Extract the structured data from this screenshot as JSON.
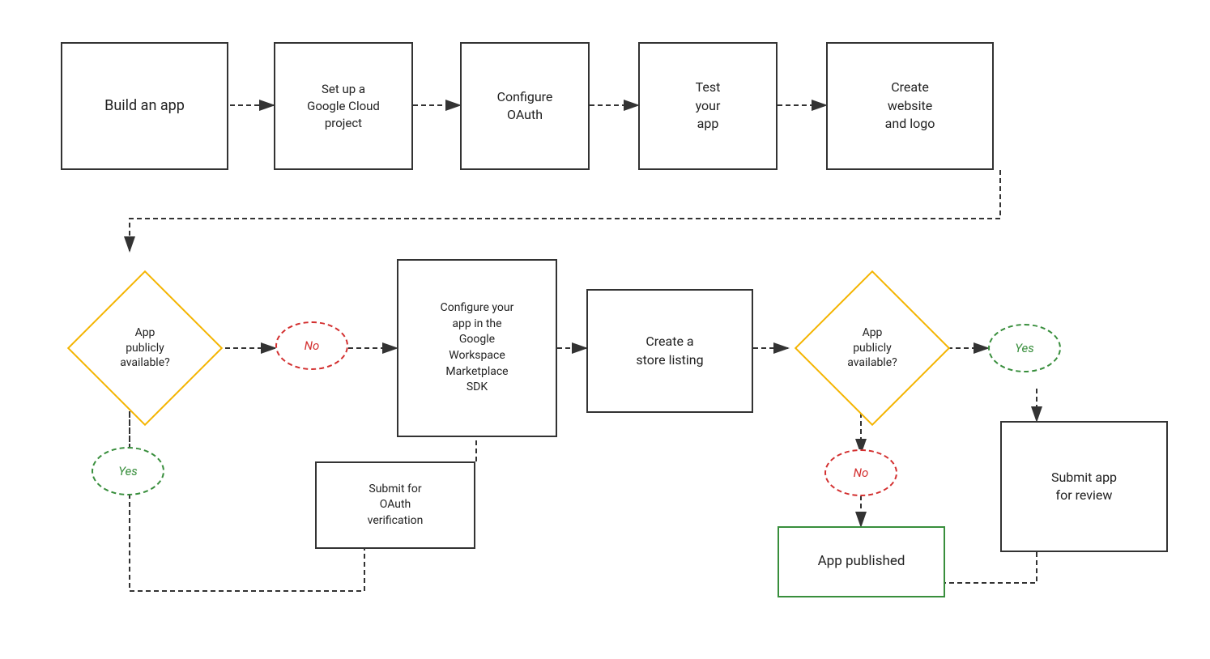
{
  "boxes": {
    "build_app": {
      "label": "Build\nan app"
    },
    "setup_gcp": {
      "label": "Set up a\nGoogle Cloud\nproject"
    },
    "configure_oauth": {
      "label": "Configure\nOAuth"
    },
    "test_app": {
      "label": "Test\nyour\napp"
    },
    "create_website": {
      "label": "Create\nwebsite\nand logo"
    },
    "configure_workspace": {
      "label": "Configure your\napp in the\nGoogle\nWorkspace\nMarketplace\nSDK"
    },
    "create_store": {
      "label": "Create a\nstore listing"
    },
    "submit_oauth": {
      "label": "Submit for\nOAuth\nverification"
    },
    "submit_review": {
      "label": "Submit app\nfor review"
    },
    "app_published": {
      "label": "App published"
    }
  },
  "diamonds": {
    "app_public_left": {
      "label": "App\npublicly\navailable?"
    },
    "app_public_right": {
      "label": "App\npublicly\navailable?"
    }
  },
  "ovals": {
    "no_left": {
      "label": "No"
    },
    "yes_left": {
      "label": "Yes"
    },
    "yes_right": {
      "label": "Yes"
    },
    "no_right": {
      "label": "No"
    }
  }
}
